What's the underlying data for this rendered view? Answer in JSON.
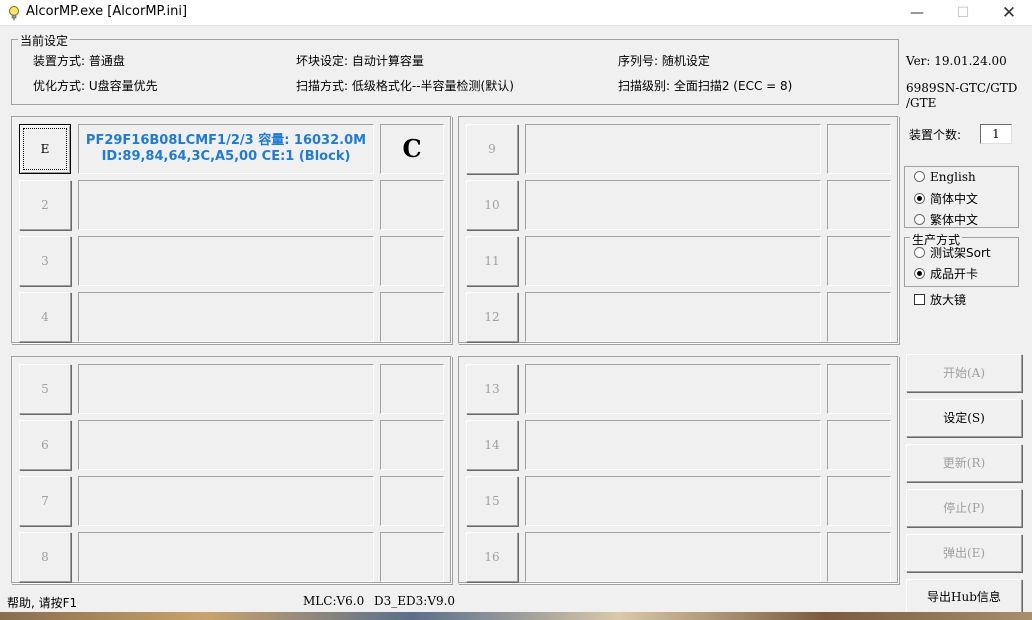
{
  "window": {
    "title": "AlcorMP.exe [AlcorMP.ini]",
    "min_glyph": "—",
    "max_glyph": "☐",
    "close_glyph": "✕",
    "app_icon": "lightbulb-icon"
  },
  "settings": {
    "legend": "当前设定",
    "device_mode": "装置方式: 普通盘",
    "optimize_mode": "优化方式: U盘容量优先",
    "bad_block": "坏块设定: 自动计算容量",
    "scan_mode": "扫描方式: 低级格式化--半容量检测(默认)",
    "serial": "序列号: 随机设定",
    "scan_level": "扫描级别: 全面扫描2 (ECC = 8)"
  },
  "ports": [
    {
      "label": "E",
      "info_line1": "PF29F16B08LCMF1/2/3 容量: 16032.0M",
      "info_line2": "ID:89,84,64,3C,A5,00 CE:1 (Block)",
      "status": "C"
    },
    {
      "label": "2",
      "info_line1": "",
      "info_line2": "",
      "status": ""
    },
    {
      "label": "3",
      "info_line1": "",
      "info_line2": "",
      "status": ""
    },
    {
      "label": "4",
      "info_line1": "",
      "info_line2": "",
      "status": ""
    },
    {
      "label": "5",
      "info_line1": "",
      "info_line2": "",
      "status": ""
    },
    {
      "label": "6",
      "info_line1": "",
      "info_line2": "",
      "status": ""
    },
    {
      "label": "7",
      "info_line1": "",
      "info_line2": "",
      "status": ""
    },
    {
      "label": "8",
      "info_line1": "",
      "info_line2": "",
      "status": ""
    },
    {
      "label": "9",
      "info_line1": "",
      "info_line2": "",
      "status": ""
    },
    {
      "label": "10",
      "info_line1": "",
      "info_line2": "",
      "status": ""
    },
    {
      "label": "11",
      "info_line1": "",
      "info_line2": "",
      "status": ""
    },
    {
      "label": "12",
      "info_line1": "",
      "info_line2": "",
      "status": ""
    },
    {
      "label": "13",
      "info_line1": "",
      "info_line2": "",
      "status": ""
    },
    {
      "label": "14",
      "info_line1": "",
      "info_line2": "",
      "status": ""
    },
    {
      "label": "15",
      "info_line1": "",
      "info_line2": "",
      "status": ""
    },
    {
      "label": "16",
      "info_line1": "",
      "info_line2": "",
      "status": ""
    }
  ],
  "sidebar": {
    "version": "Ver: 19.01.24.00",
    "chip_line1": "6989SN-GTC/GTD",
    "chip_line2": "/GTE",
    "device_count_label": "装置个数:",
    "device_count_value": "1",
    "languages": [
      {
        "label": "English",
        "selected": false
      },
      {
        "label": "简体中文",
        "selected": true
      },
      {
        "label": "繁体中文",
        "selected": false
      }
    ],
    "production_legend": "生产方式",
    "production_modes": [
      {
        "label": "测试架Sort",
        "selected": false
      },
      {
        "label": "成品开卡",
        "selected": true
      }
    ],
    "magnifier_label": "放大镜",
    "magnifier_checked": false
  },
  "actions": {
    "start": "开始(A)",
    "settings": "设定(S)",
    "update": "更新(R)",
    "stop": "停止(P)",
    "eject": "弹出(E)",
    "export_hub": "导出Hub信息"
  },
  "statusbar": {
    "help": "帮助, 请按F1",
    "mlc": "MLC:V6.0",
    "d3": "D3_ED3:V9.0"
  },
  "colors": {
    "info_text": "#1e7bd8",
    "disabled_text": "#a0a0a0"
  }
}
